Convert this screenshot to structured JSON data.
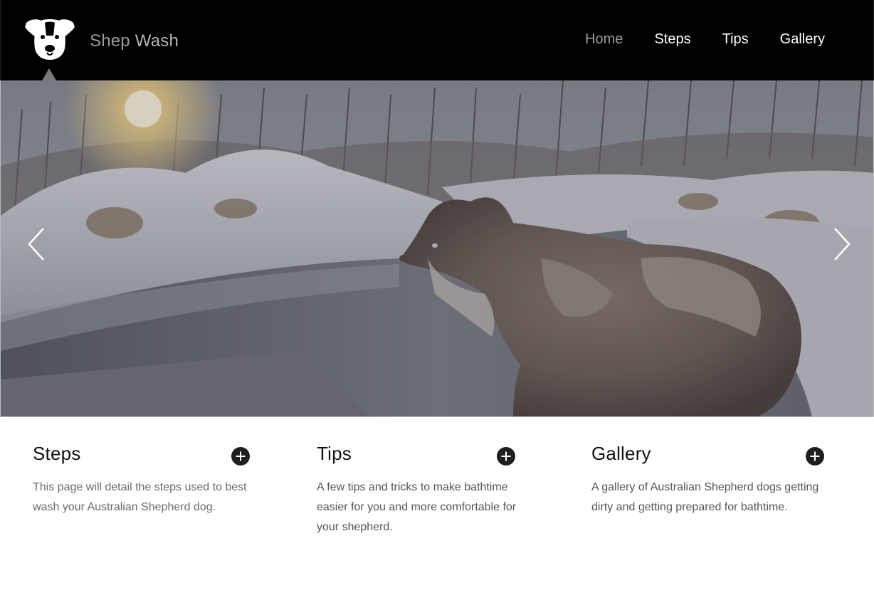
{
  "brand": {
    "name_part1": "Shep",
    "name_part2": "Wash"
  },
  "nav": {
    "items": [
      {
        "label": "Home",
        "active": true
      },
      {
        "label": "Steps",
        "active": false
      },
      {
        "label": "Tips",
        "active": false
      },
      {
        "label": "Gallery",
        "active": false
      }
    ]
  },
  "hero": {
    "image": "snowy-creek-australian-shepherd",
    "prev_icon": "chevron-left-icon",
    "next_icon": "chevron-right-icon"
  },
  "cards": [
    {
      "title": "Steps",
      "text": "This page will detail the steps used to best wash your Australian Shepherd dog.",
      "icon": "plus-circle-icon"
    },
    {
      "title": "Tips",
      "text": "A few tips and tricks to make bathtime easier for you and more comfortable for your shepherd.",
      "icon": "plus-circle-icon"
    },
    {
      "title": "Gallery",
      "text": "A gallery of Australian Shepherd dogs getting dirty and getting prepared for bathtime.",
      "icon": "plus-circle-icon"
    }
  ],
  "colors": {
    "header_bg": "#000000",
    "nav_active": "#9a9a9a",
    "icon_dark": "#1e1e1e"
  }
}
